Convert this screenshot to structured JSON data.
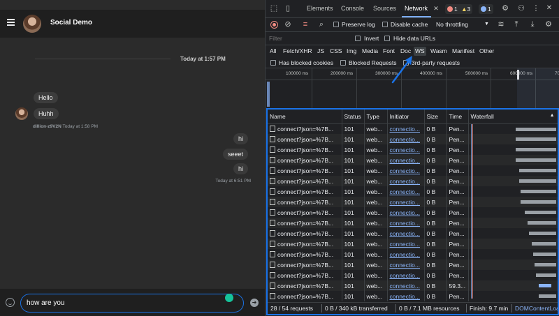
{
  "chat": {
    "title": "Social Demo",
    "date_separator": "Today at 1:57 PM",
    "incoming": [
      "Hello",
      "Huhh"
    ],
    "incoming_meta_user": "dillion-z9V2N",
    "incoming_meta_time": "Today at 1:58 PM",
    "outgoing": [
      "hi",
      "seeet",
      "hi"
    ],
    "outgoing_meta_time": "Today at 6:51 PM",
    "input_value": "how are you"
  },
  "devtools": {
    "tabs": [
      "Elements",
      "Console",
      "Sources",
      "Network"
    ],
    "active_tab": "Network",
    "errors_count": "1",
    "warnings_count": "3",
    "issues_count": "1",
    "toolbar": {
      "preserve_log": "Preserve log",
      "disable_cache": "Disable cache",
      "throttling": "No throttling"
    },
    "filter": {
      "placeholder": "Filter",
      "invert": "Invert",
      "hide_data_urls": "Hide data URLs"
    },
    "types": [
      "All",
      "Fetch/XHR",
      "JS",
      "CSS",
      "Img",
      "Media",
      "Font",
      "Doc",
      "WS",
      "Wasm",
      "Manifest",
      "Other"
    ],
    "selected_type": "WS",
    "options": {
      "blocked_cookies": "Has blocked cookies",
      "blocked_requests": "Blocked Requests",
      "third_party": "3rd-party requests"
    },
    "overview_ticks": [
      "100000 ms",
      "200000 ms",
      "300000 ms",
      "400000 ms",
      "500000 ms",
      "600000 ms",
      "70"
    ],
    "columns": [
      "Name",
      "Status",
      "Type",
      "Initiator",
      "Size",
      "Time",
      "Waterfall"
    ],
    "rows": [
      {
        "name": "connect?json=%7B...",
        "status": "101",
        "type": "web...",
        "initiator": "connectio...",
        "size": "0 B",
        "time": "Pen..."
      },
      {
        "name": "connect?json=%7B...",
        "status": "101",
        "type": "web...",
        "initiator": "connectio...",
        "size": "0 B",
        "time": "Pen..."
      },
      {
        "name": "connect?json=%7B...",
        "status": "101",
        "type": "web...",
        "initiator": "connectio...",
        "size": "0 B",
        "time": "Pen..."
      },
      {
        "name": "connect?json=%7B...",
        "status": "101",
        "type": "web...",
        "initiator": "connectio...",
        "size": "0 B",
        "time": "Pen..."
      },
      {
        "name": "connect?json=%7B...",
        "status": "101",
        "type": "web...",
        "initiator": "connectio...",
        "size": "0 B",
        "time": "Pen..."
      },
      {
        "name": "connect?json=%7B...",
        "status": "101",
        "type": "web...",
        "initiator": "connectio...",
        "size": "0 B",
        "time": "Pen..."
      },
      {
        "name": "connect?json=%7B...",
        "status": "101",
        "type": "web...",
        "initiator": "connectio...",
        "size": "0 B",
        "time": "Pen..."
      },
      {
        "name": "connect?json=%7B...",
        "status": "101",
        "type": "web...",
        "initiator": "connectio...",
        "size": "0 B",
        "time": "Pen..."
      },
      {
        "name": "connect?json=%7B...",
        "status": "101",
        "type": "web...",
        "initiator": "connectio...",
        "size": "0 B",
        "time": "Pen..."
      },
      {
        "name": "connect?json=%7B...",
        "status": "101",
        "type": "web...",
        "initiator": "connectio...",
        "size": "0 B",
        "time": "Pen..."
      },
      {
        "name": "connect?json=%7B...",
        "status": "101",
        "type": "web...",
        "initiator": "connectio...",
        "size": "0 B",
        "time": "Pen..."
      },
      {
        "name": "connect?json=%7B...",
        "status": "101",
        "type": "web...",
        "initiator": "connectio...",
        "size": "0 B",
        "time": "Pen..."
      },
      {
        "name": "connect?json=%7B...",
        "status": "101",
        "type": "web...",
        "initiator": "connectio...",
        "size": "0 B",
        "time": "Pen..."
      },
      {
        "name": "connect?json=%7B...",
        "status": "101",
        "type": "web...",
        "initiator": "connectio...",
        "size": "0 B",
        "time": "Pen..."
      },
      {
        "name": "connect?json=%7B...",
        "status": "101",
        "type": "web...",
        "initiator": "connectio...",
        "size": "0 B",
        "time": "Pen..."
      },
      {
        "name": "connect?json=%7B...",
        "status": "101",
        "type": "web...",
        "initiator": "connectio...",
        "size": "0 B",
        "time": "59.3..."
      },
      {
        "name": "connect?json=%7B...",
        "status": "101",
        "type": "web...",
        "initiator": "connectio...",
        "size": "0 B",
        "time": "Pen..."
      }
    ],
    "status": {
      "requests": "28 / 54 requests",
      "transferred": "0 B / 340 kB transferred",
      "resources": "0 B / 7.1 MB resources",
      "finish": "Finish: 9.7 min",
      "dom_loaded": "DOMContentLoaded: 2..."
    }
  }
}
